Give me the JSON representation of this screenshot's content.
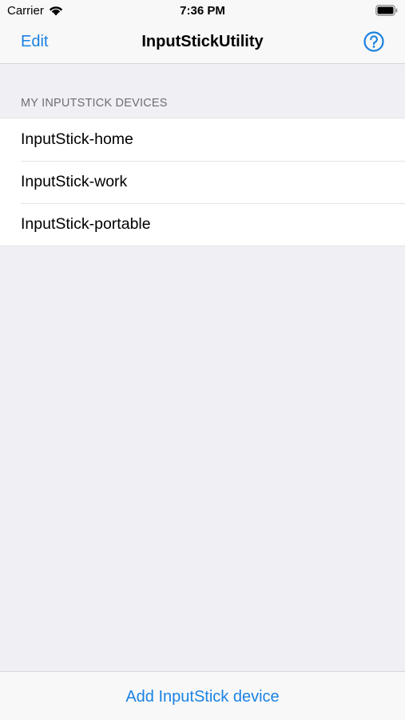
{
  "status_bar": {
    "carrier": "Carrier",
    "time": "7:36 PM",
    "wifi_icon": "wifi-icon",
    "battery_icon": "battery-icon"
  },
  "nav": {
    "edit_label": "Edit",
    "title": "InputStickUtility",
    "help_icon": "question-circle-icon",
    "accent_color": "#1a82e2"
  },
  "devices": {
    "section_header": "MY INPUTSTICK DEVICES",
    "items": [
      {
        "label": "InputStick-home"
      },
      {
        "label": "InputStick-work"
      },
      {
        "label": "InputStick-portable"
      }
    ]
  },
  "toolbar": {
    "add_label": "Add InputStick device"
  }
}
